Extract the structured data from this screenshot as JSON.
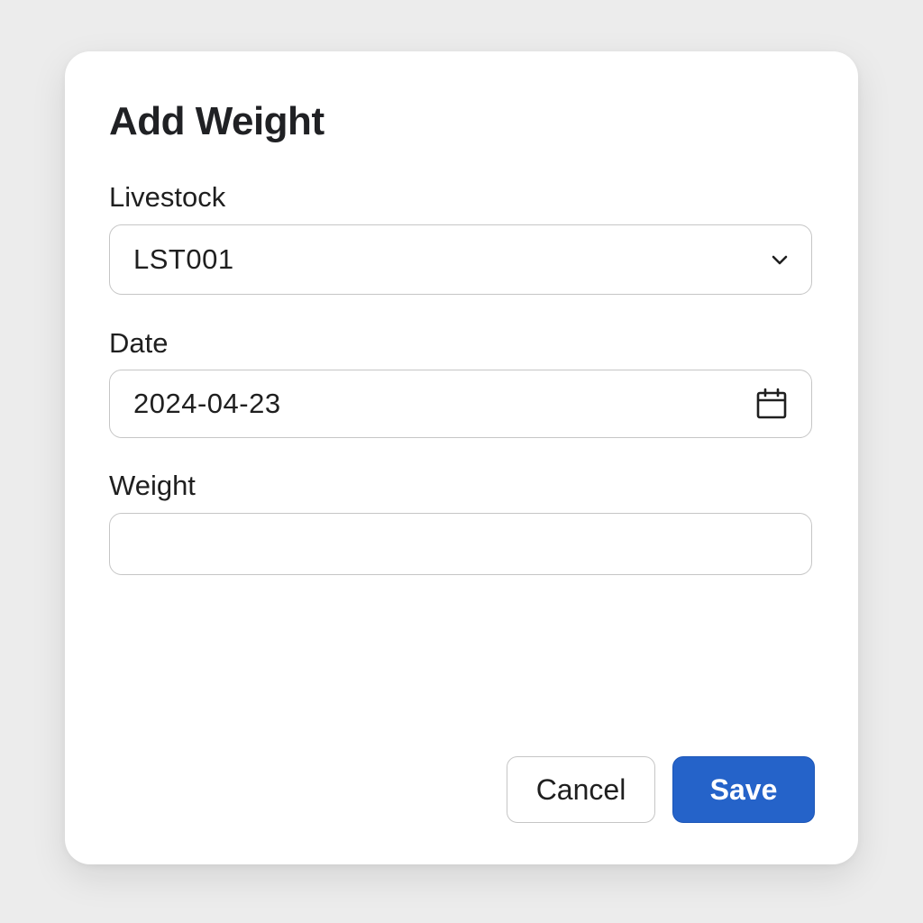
{
  "dialog": {
    "title": "Add Weight"
  },
  "fields": {
    "livestock": {
      "label": "Livestock",
      "value": "LST001",
      "icon": "chevron-down-icon"
    },
    "date": {
      "label": "Date",
      "value": "2024-04-23",
      "icon": "calendar-icon"
    },
    "weight": {
      "label": "Weight",
      "value": ""
    }
  },
  "actions": {
    "cancel_label": "Cancel",
    "save_label": "Save"
  },
  "colors": {
    "primary": "#2563c9",
    "background": "#ececec",
    "border": "#c6c6c6"
  }
}
